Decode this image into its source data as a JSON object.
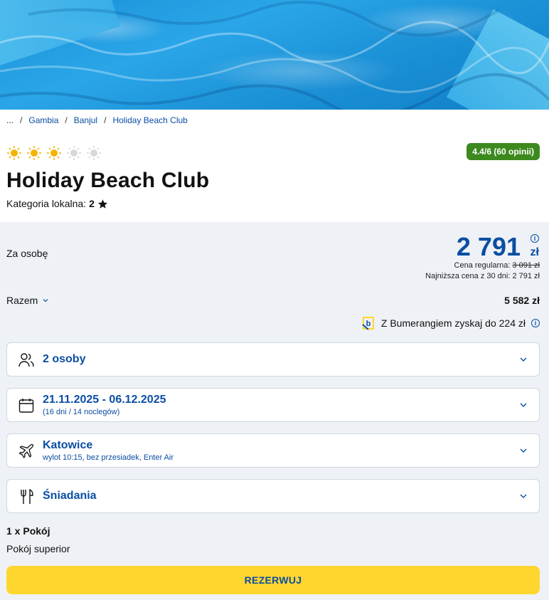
{
  "hero": {
    "image": "pool-water-photo"
  },
  "breadcrumb": {
    "ellipsis": "...",
    "separator": "/",
    "items": [
      "Gambia",
      "Banjul",
      "Holiday Beach Club"
    ]
  },
  "hotel": {
    "stars_filled": 3,
    "stars_total": 5,
    "rating_badge": "4.4/6 (60 opinii)",
    "name": "Holiday Beach Club",
    "category_label": "Kategoria lokalna:",
    "category_value": "2"
  },
  "pricing": {
    "per_person_label": "Za osobę",
    "price": "2 791",
    "currency": "zł",
    "regular_label": "Cena regularna:",
    "regular_value": "3 091 zł",
    "lowest_label": "Najniższa cena z 30 dni: 2 791 zł",
    "total_label": "Razem",
    "total_value": "5 582 zł",
    "bumerang_text": "Z Bumerangiem zyskaj do 224 zł"
  },
  "options": {
    "persons": {
      "title": "2 osoby",
      "icon": "users-icon"
    },
    "dates": {
      "title": "21.11.2025 - 06.12.2025",
      "sub": "(16 dni / 14 noclegów)",
      "icon": "calendar-icon"
    },
    "flight": {
      "title": "Katowice",
      "sub": "wylot 10:15, bez przesiadek, Enter Air",
      "icon": "plane-icon"
    },
    "board": {
      "title": "Śniadania",
      "icon": "cutlery-icon"
    }
  },
  "room": {
    "count": "1 x Pokój",
    "type": "Pokój superior"
  },
  "book_button": "REZERWUJ",
  "colors": {
    "accent_blue": "#0b4ea2",
    "rating_green": "#3c8a1e",
    "button_yellow": "#ffd62e",
    "panel_bg": "#eef2f6",
    "sun_active": "#f5b301",
    "sun_inactive": "#d8d8d8"
  }
}
